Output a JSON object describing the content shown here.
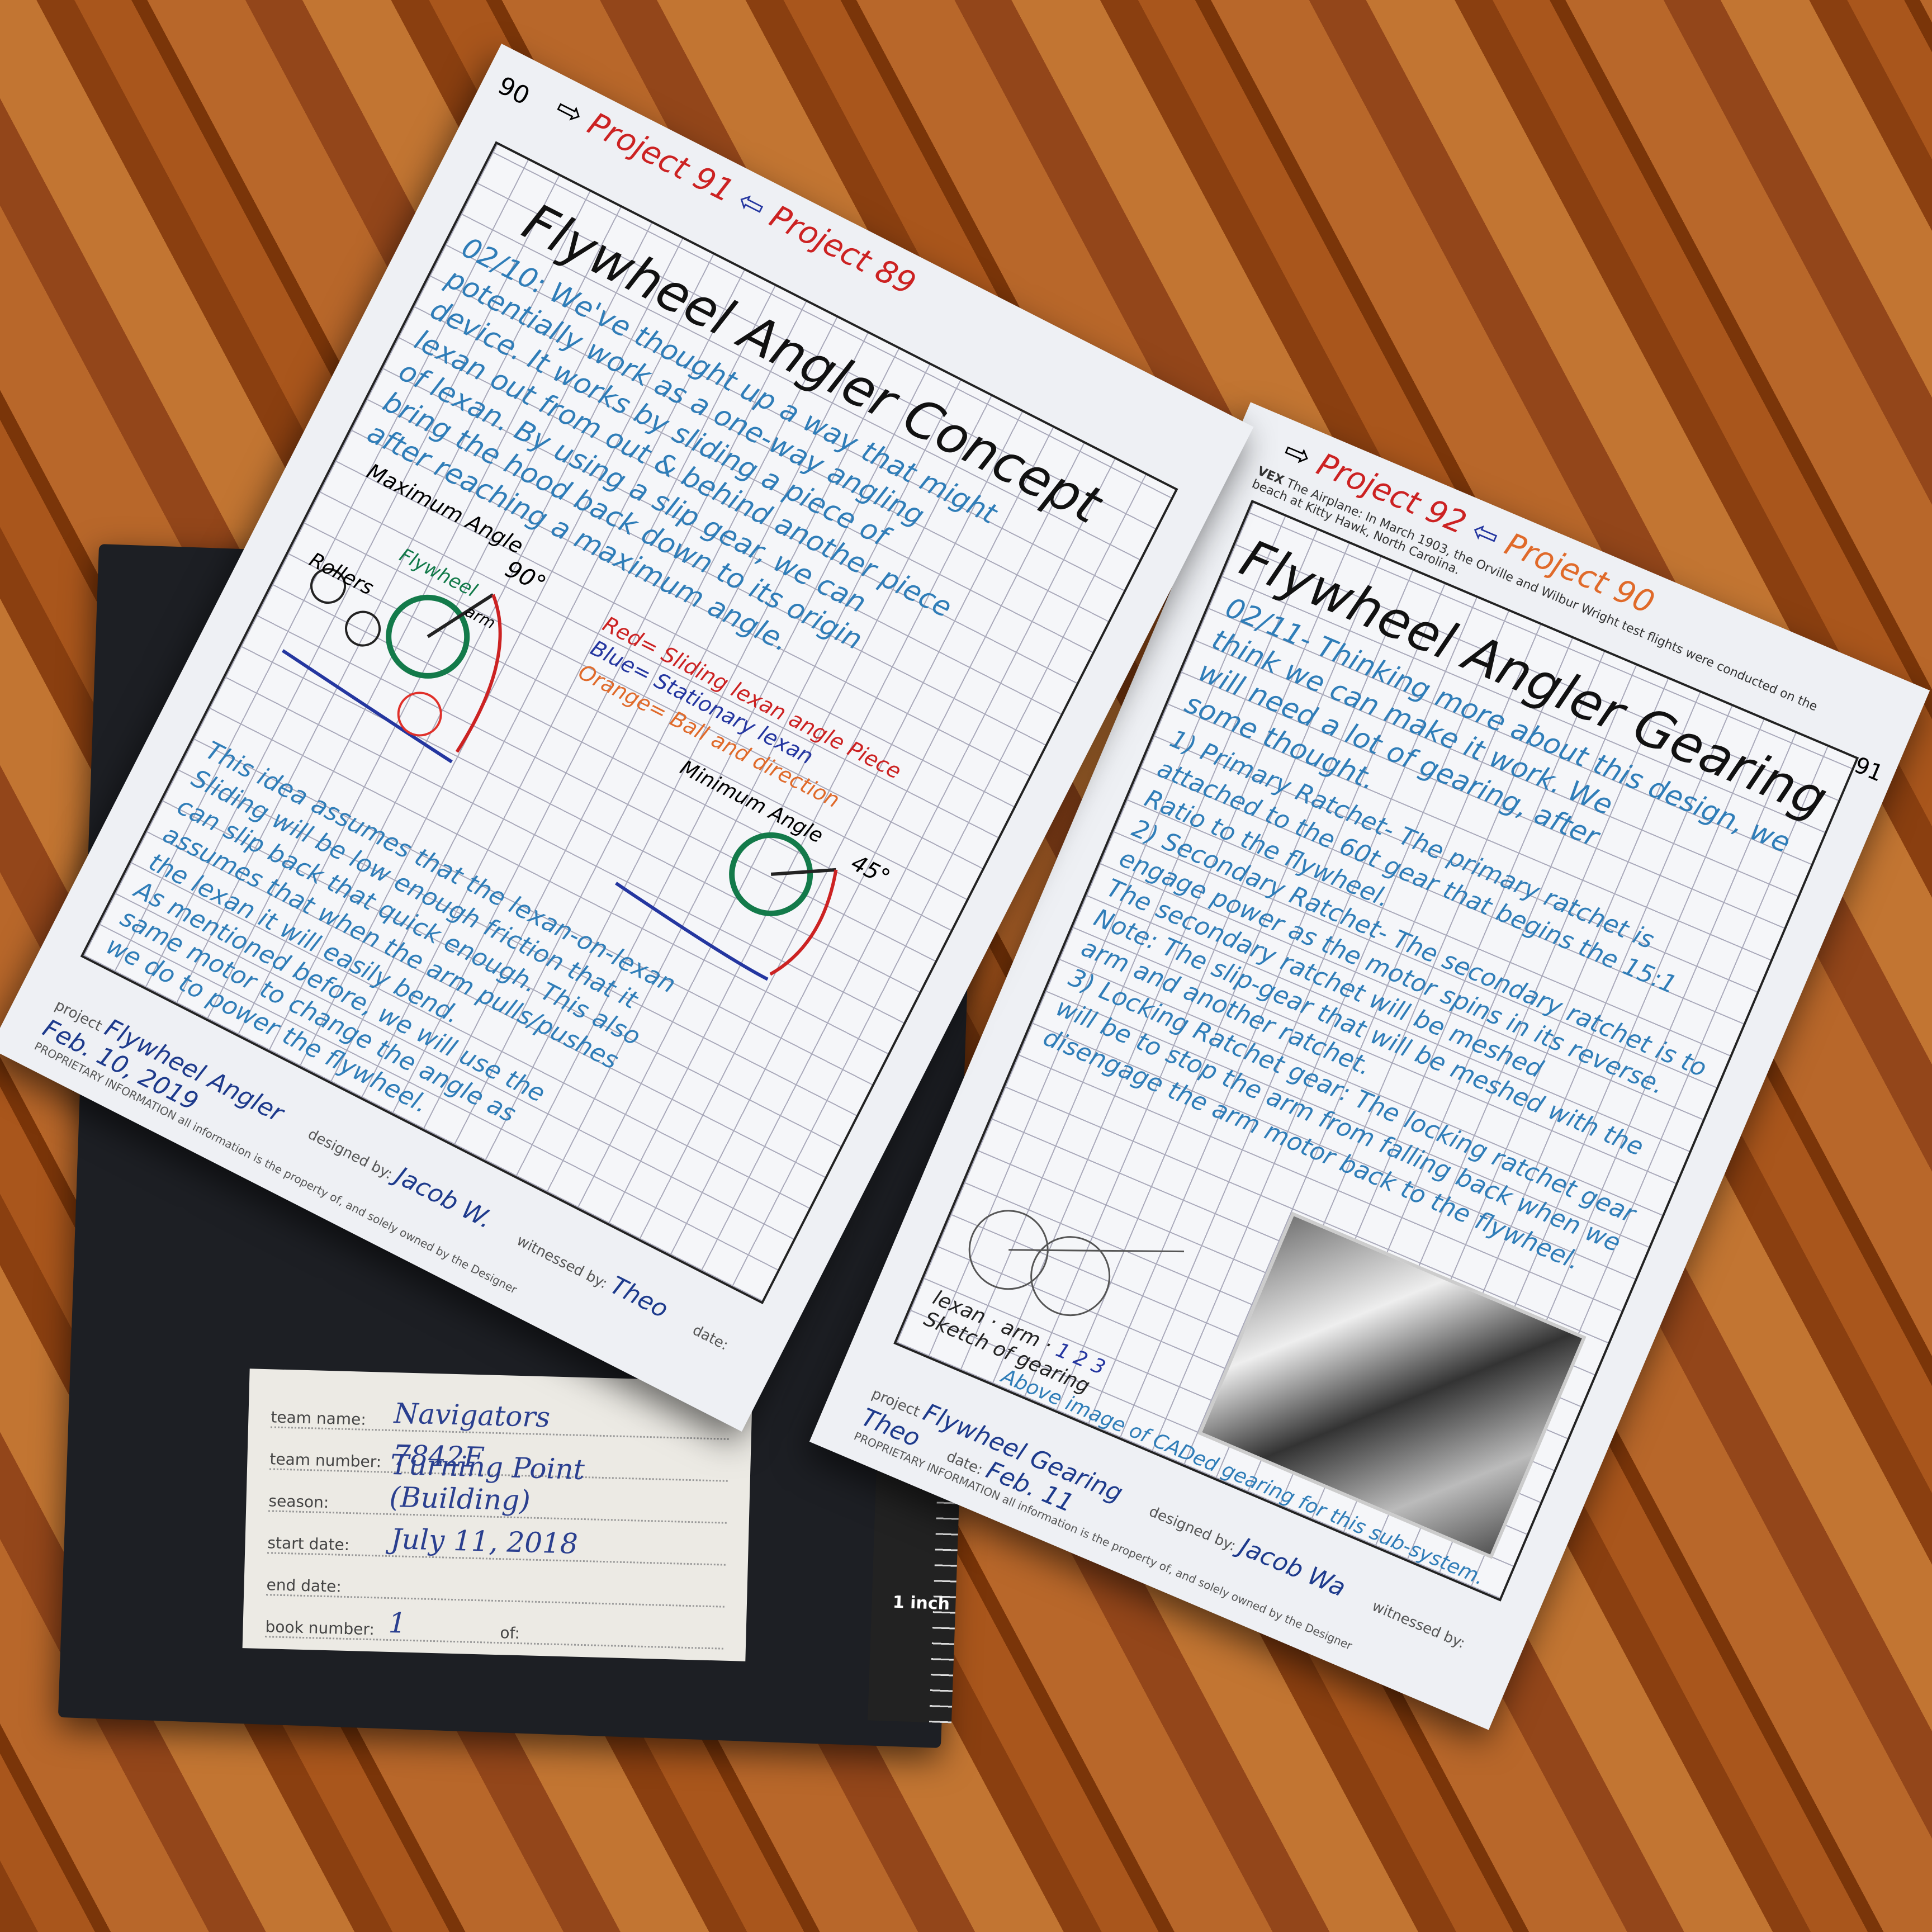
{
  "cover": {
    "label": {
      "fields": [
        {
          "key": "team name:",
          "value": "Navigators"
        },
        {
          "key": "team number:",
          "value": "7842F"
        },
        {
          "key": "season:",
          "value": "Turning Point (Building)"
        },
        {
          "key": "start date:",
          "value": "July 11, 2018"
        },
        {
          "key": "end date:",
          "value": ""
        },
        {
          "key": "book number:",
          "value": "1",
          "extra": "of:"
        }
      ]
    },
    "ruler_label": "1 inch"
  },
  "left_page": {
    "page_number": "90",
    "nav": {
      "next": "Project 91",
      "prev": "Project 89"
    },
    "title": "Flywheel Angler Concept",
    "entry": [
      "02/10: We've thought up a way that might",
      "potentially work as a one-way angling",
      "device. It works by sliding a piece of",
      "lexan out from out & behind another piece",
      "of lexan. By using a slip gear, we can",
      "bring the hood back down to its origin",
      "after reaching a maximum angle."
    ],
    "sketch_labels": {
      "max": "Maximum Angle",
      "deg90": "90°",
      "flywheel": "Flywheel",
      "arm": "arm",
      "rollers": "Rollers",
      "min": "Minimum Angle",
      "deg45": "45°"
    },
    "legend": [
      "Red= Sliding lexan angle Piece",
      "Blue= Stationary lexan",
      "Orange= Ball and direction"
    ],
    "notes": [
      "This idea assumes that the lexan-on-lexan",
      "Sliding will be low enough friction that it",
      "can slip back that quick enough. This also",
      "assumes that when the arm pulls/pushes",
      "the lexan it will easily bend.",
      "As mentioned before, we will use the",
      "same motor to change the angle as",
      "we do to power the flywheel."
    ],
    "footer": {
      "project_label": "project",
      "project": "Flywheel Angler",
      "designed_label": "designed by:",
      "designed": "Jacob W.",
      "witnessed_label": "witnessed by:",
      "witnessed": "Theo",
      "date_label": "date:",
      "date": "Feb. 10, 2019",
      "proprietary": "PROPRIETARY INFORMATION all information is the property of, and solely owned by the Designer"
    }
  },
  "right_page": {
    "page_number": "91",
    "nav": {
      "next": "Project 92",
      "prev": "Project 90"
    },
    "brand": "VEX",
    "quote": "The Airplane: In March 1903, the Orville and Wilbur Wright test flights were conducted on the beach at Kitty Hawk, North Carolina.",
    "title": "Flywheel Angler Gearing",
    "entry": [
      "02/11- Thinking more about this design, we",
      "think we can make it work. We",
      "will need a lot of gearing, after",
      "some thought."
    ],
    "items": [
      "1) Primary Ratchet- The primary ratchet is attached to the 60t gear that begins the 15:1 Ratio to the flywheel.",
      "2) Secondary Ratchet- The secondary ratchet is to engage power as the motor spins in its reverse. The secondary ratchet will be meshed",
      "Note: The slip-gear that will be meshed with the arm and another ratchet.",
      "3) Locking Ratchet gear: The locking ratchet gear will be to stop the arm from falling back when we disengage the arm motor back to the flywheel."
    ],
    "sketch_labels": {
      "lexan": "lexan",
      "arm": "arm",
      "n1": "1",
      "n2": "2",
      "n3": "3",
      "caption": "Sketch of gearing"
    },
    "photo_caption": "Above image of CADed gearing for this sub-system.",
    "footer": {
      "project_label": "project",
      "project": "Flywheel Gearing",
      "designed_label": "designed by:",
      "designed": "Jacob Wa",
      "witnessed_label": "witnessed by:",
      "witnessed": "Theo",
      "date_label": "date:",
      "date": "Feb. 11",
      "proprietary": "PROPRIETARY INFORMATION all information is the property of, and solely owned by the Designer"
    }
  }
}
